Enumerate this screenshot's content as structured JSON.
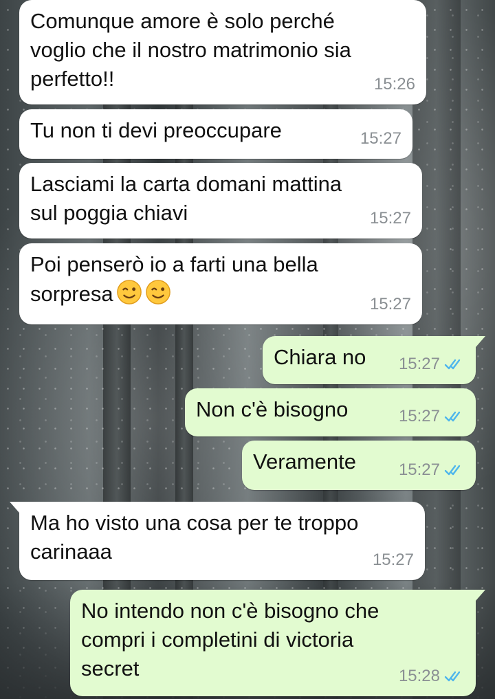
{
  "chat": {
    "messages": [
      {
        "dir": "in",
        "text": "Comunque amore è solo perché\nvoglio che il nostro matrimonio sia\nperfetto!!",
        "time": "15:26"
      },
      {
        "dir": "in",
        "text": "Tu non ti devi preoccupare",
        "time": "15:27"
      },
      {
        "dir": "in",
        "text": "Lasciami la carta domani mattina\nsul poggia chiavi",
        "time": "15:27"
      },
      {
        "dir": "in",
        "text": "Poi penserò io a farti una bella\nsorpresa",
        "emoji": "😉😉",
        "emoji_icons": [
          "winking-face-emoji",
          "winking-face-emoji"
        ],
        "time": "15:27"
      },
      {
        "dir": "out",
        "text": "Chiara no",
        "time": "15:27",
        "status": "read"
      },
      {
        "dir": "out",
        "text": "Non c'è bisogno",
        "time": "15:27",
        "status": "read"
      },
      {
        "dir": "out",
        "text": "Veramente",
        "time": "15:27",
        "status": "read"
      },
      {
        "dir": "in",
        "text": "Ma ho visto una cosa per te troppo\ncarinaaa",
        "time": "15:27"
      },
      {
        "dir": "out",
        "text": "No intendo non c'è bisogno che\ncompri i completini di victoria\nsecret",
        "time": "15:28",
        "status": "read"
      }
    ]
  },
  "colors": {
    "incoming_bubble": "#ffffff",
    "outgoing_bubble": "#e2fbd0",
    "read_ticks": "#4fb6ec",
    "timestamp": "#8a8f93"
  },
  "icons": {
    "read_receipt": "double-check-icon"
  }
}
